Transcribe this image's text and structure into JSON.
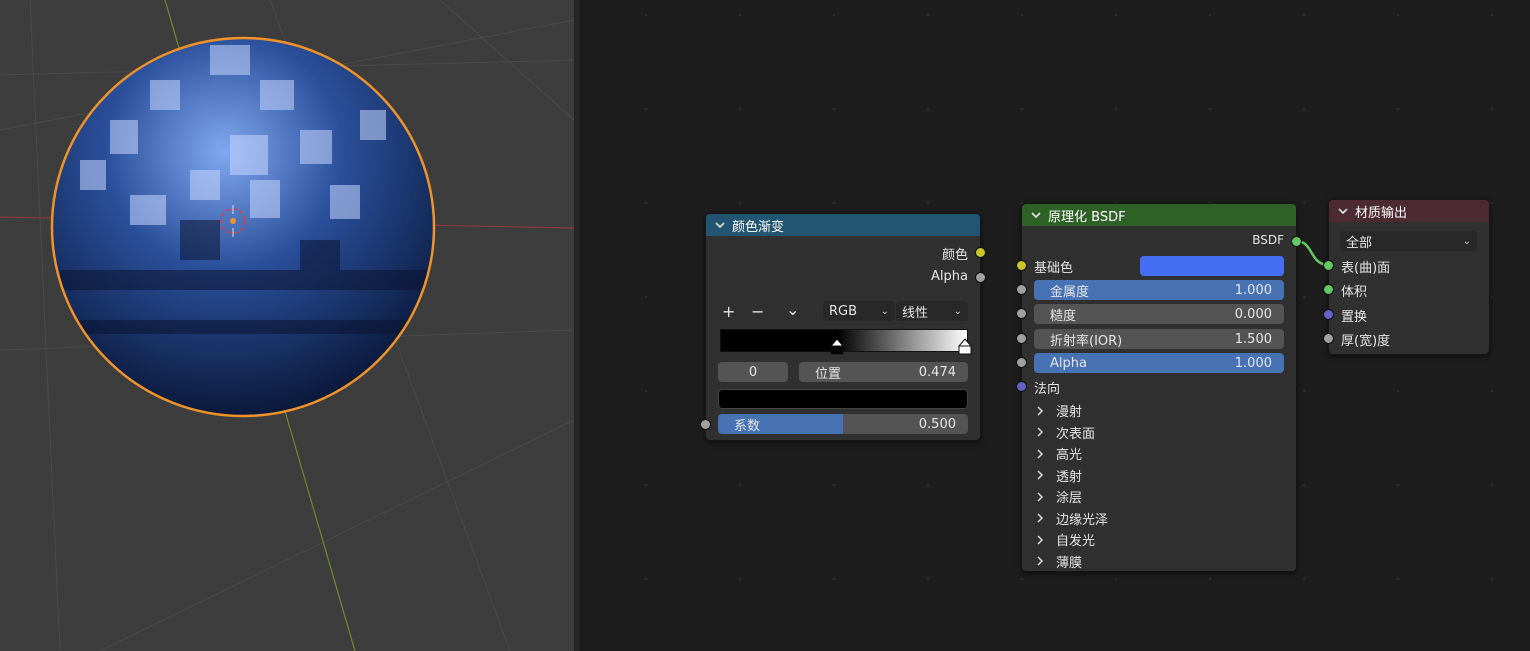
{
  "colors": {
    "viewport_bg": "#3d3d3d",
    "editor_bg": "#1d1d1d",
    "color_ramp_header": "#225571",
    "bsdf_header": "#2e6126",
    "output_header": "#4c2a31",
    "field_blue": "#4772b3",
    "base_color_swatch": "#456ef5",
    "selection_outline": "#f0932b"
  },
  "color_ramp": {
    "title": "颜色渐变",
    "outputs": [
      "颜色",
      "Alpha"
    ],
    "toolbar": {
      "add": "+",
      "remove": "−",
      "more": "⌄"
    },
    "color_mode": "RGB",
    "interpolation": "线性",
    "ramp_stops": [
      0.0,
      1.0
    ],
    "active_stop_index": "0",
    "position_label": "位置",
    "position_value": "0.474",
    "active_color": "#000000",
    "factor_label": "系数",
    "factor_value": "0.500",
    "factor_fraction": 0.5
  },
  "bsdf": {
    "title": "原理化 BSDF",
    "output": "BSDF",
    "base_color_label": "基础色",
    "metallic": {
      "label": "金属度",
      "value": "1.000"
    },
    "roughness": {
      "label": "糙度",
      "value": "0.000"
    },
    "ior": {
      "label": "折射率(IOR)",
      "value": "1.500"
    },
    "alpha": {
      "label": "Alpha",
      "value": "1.000"
    },
    "normal_label": "法向",
    "panels": [
      "漫射",
      "次表面",
      "高光",
      "透射",
      "涂层",
      "边缘光泽",
      "自发光",
      "薄膜"
    ]
  },
  "material_output": {
    "title": "材质输出",
    "target": "全部",
    "inputs": [
      "表(曲)面",
      "体积",
      "置换",
      "厚(宽)度"
    ]
  }
}
